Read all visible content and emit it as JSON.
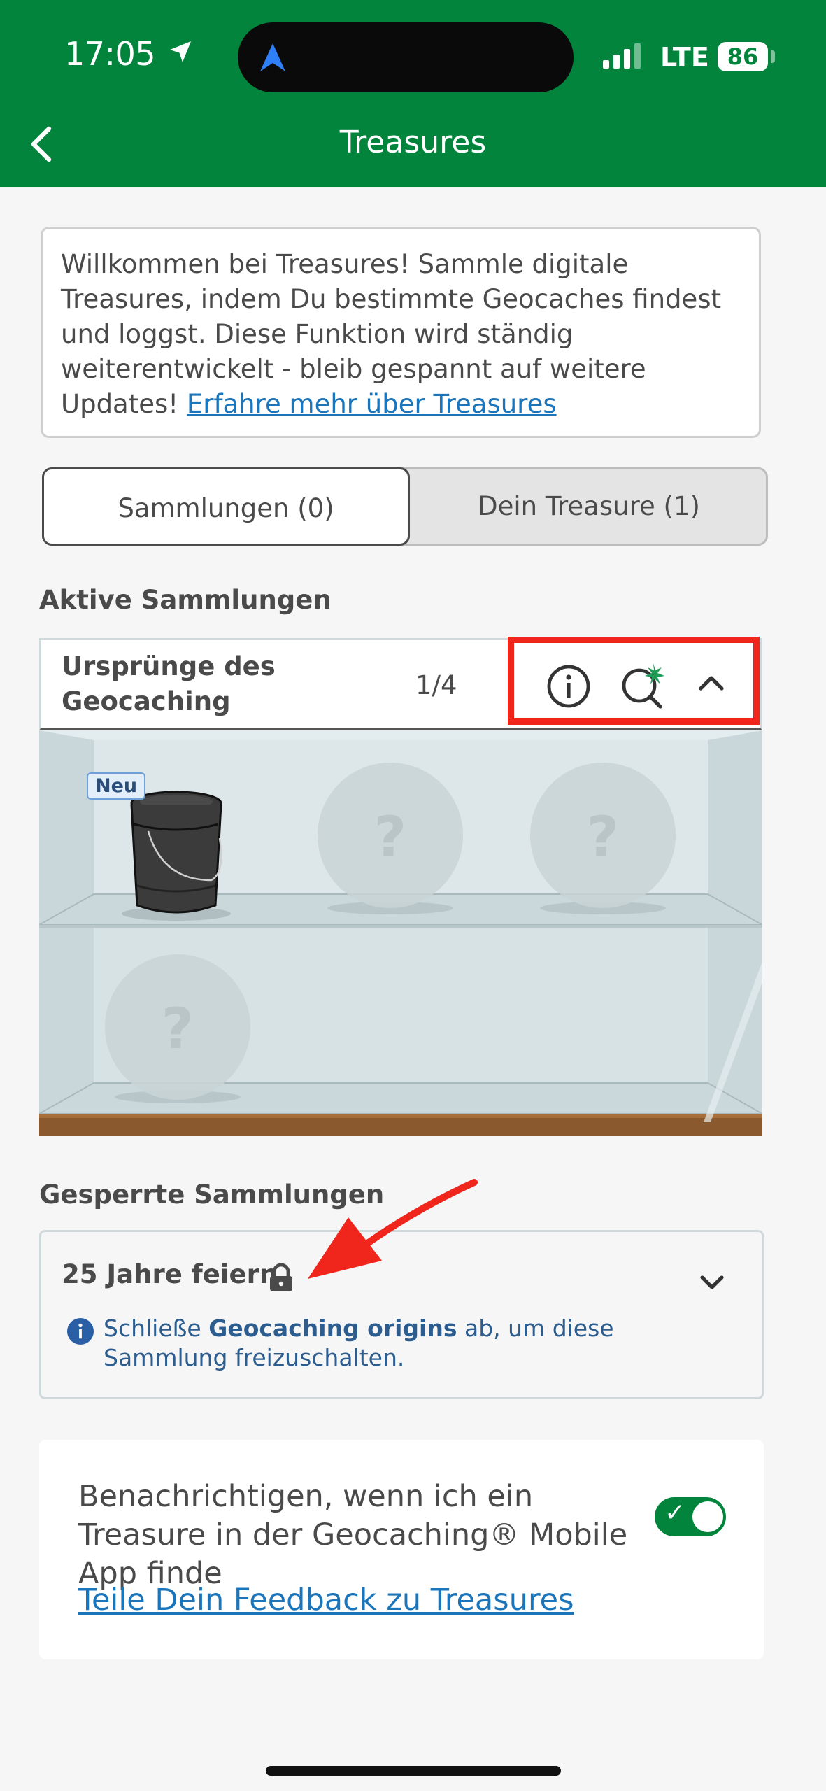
{
  "status": {
    "time": "17:05",
    "network": "LTE",
    "battery": "86"
  },
  "header": {
    "title": "Treasures"
  },
  "intro": {
    "text": "Willkommen bei Treasures! Sammle digitale Treasures, indem Du bestimmte Geocaches findest und loggst. Diese Funktion wird ständig weiterentwickelt - bleib gespannt auf weitere Updates! ",
    "link": "Erfahre mehr über Treasures"
  },
  "tabs": [
    {
      "label": "Sammlungen (0)"
    },
    {
      "label": "Dein Treasure (1)"
    }
  ],
  "active_section": {
    "title": "Aktive Sammlungen"
  },
  "collection": {
    "name": "Ursprünge des Geocaching",
    "progress": "1/4",
    "new_badge": "Neu",
    "unknown_mark": "?"
  },
  "locked_section": {
    "title": "Gesperrte Sammlungen",
    "item_title": "25 Jahre feiern",
    "message_prefix": "Schließe ",
    "message_bold": "Geocaching origins",
    "message_suffix": " ab, um diese Sammlung freizuschalten."
  },
  "notify": {
    "text": "Benachrichtigen, wenn ich ein Treasure in der Geocaching® Mobile App finde",
    "toggle_on": true,
    "feedback_link": "Teile Dein Feedback zu Treasures"
  },
  "colors": {
    "brand_green": "#02843d",
    "link_blue": "#1b75bb",
    "highlight_red": "#f0261c"
  }
}
